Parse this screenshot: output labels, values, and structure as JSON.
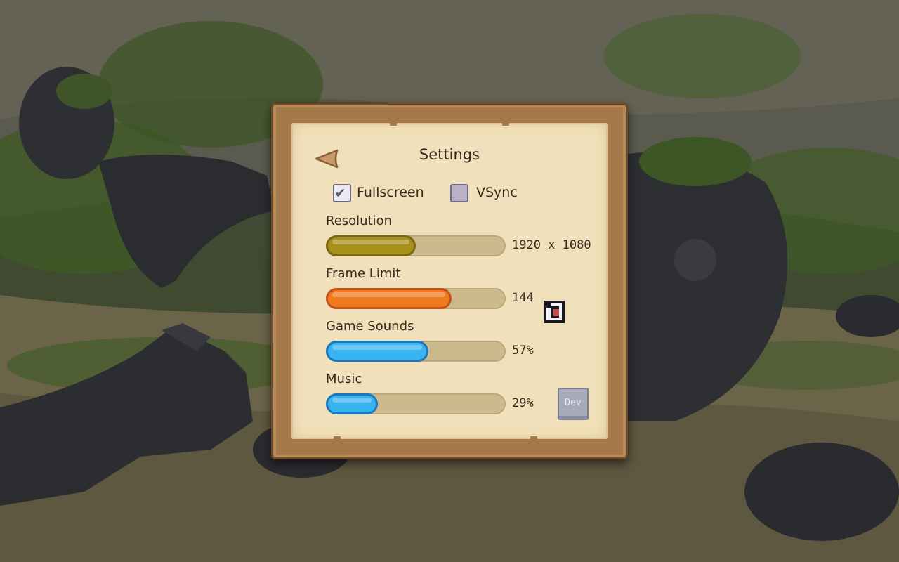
{
  "settings": {
    "title": "Settings",
    "fullscreen": {
      "label": "Fullscreen",
      "checked": true
    },
    "vsync": {
      "label": "VSync",
      "checked": false
    },
    "resolution": {
      "label": "Resolution",
      "value_text": "1920 x 1080",
      "fill_fraction": 0.5,
      "color": "#a8901c",
      "border": "#7a6810"
    },
    "frame_limit": {
      "label": "Frame Limit",
      "value_text": "144",
      "fill_fraction": 0.7,
      "color": "#f07a1e",
      "border": "#c4501a"
    },
    "game_sounds": {
      "label": "Game Sounds",
      "value_text": "57%",
      "fill_fraction": 0.57,
      "color": "#38b4f0",
      "border": "#1a78c0"
    },
    "music": {
      "label": "Music",
      "value_text": "29%",
      "fill_fraction": 0.29,
      "color": "#38b4f0",
      "border": "#1a78c0"
    },
    "dev_button": "Dev"
  },
  "icons": {
    "back": "back-arrow-icon",
    "check": "checkmark-icon",
    "cursor": "pointer-cursor-icon"
  },
  "colors": {
    "panel_frame": "#a5784a",
    "paper": "#f0e0bb",
    "text": "#3a2a1c"
  }
}
